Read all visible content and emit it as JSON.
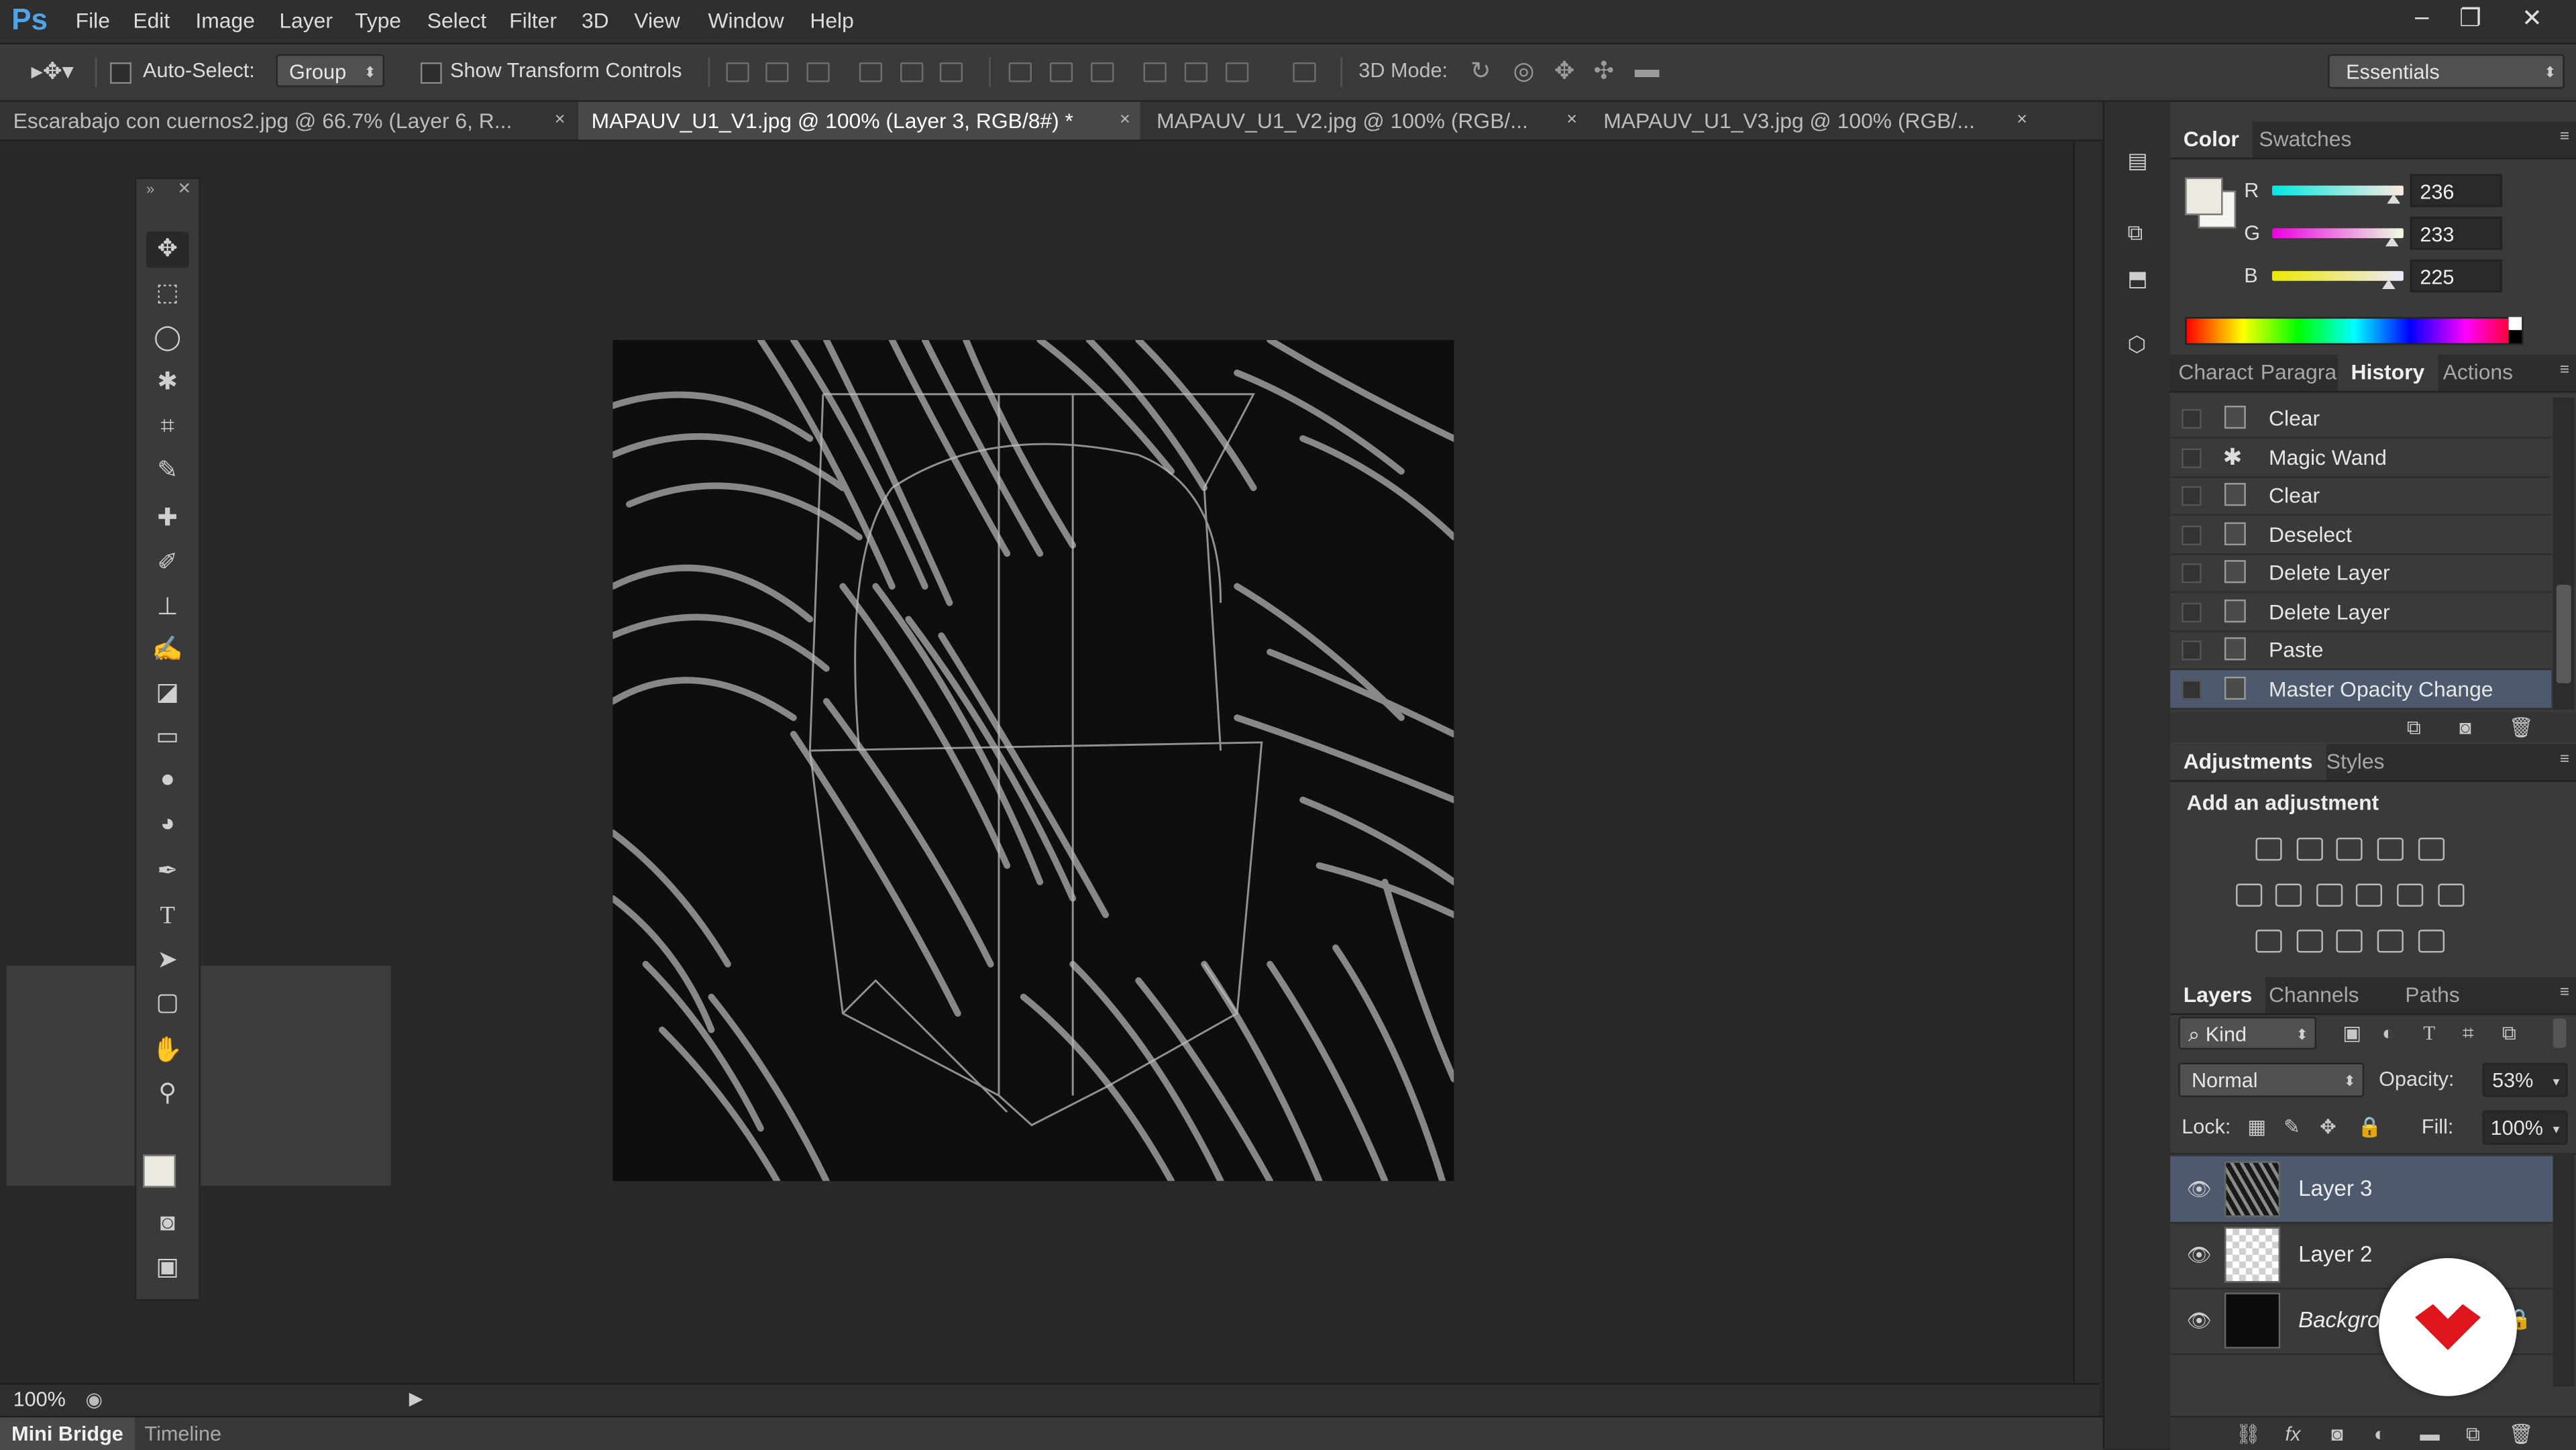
{
  "app": {
    "logo": "Ps"
  },
  "menu": [
    "File",
    "Edit",
    "Image",
    "Layer",
    "Type",
    "Select",
    "Filter",
    "3D",
    "View",
    "Window",
    "Help"
  ],
  "window_controls": {
    "minimize": "–",
    "restore": "❐",
    "close": "✕"
  },
  "options": {
    "auto_select_label": "Auto-Select:",
    "auto_select_value": "Group",
    "show_transform_label": "Show Transform Controls",
    "mode_3d_label": "3D Mode:",
    "workspace": "Essentials"
  },
  "tabs": [
    {
      "label": "Escarabajo con cuernos2.jpg @ 66.7% (Layer 6, R...",
      "close": "×"
    },
    {
      "label": "MAPAUV_U1_V1.jpg @ 100% (Layer 3, RGB/8#) *",
      "close": "×"
    },
    {
      "label": "MAPAUV_U1_V2.jpg @ 100% (RGB/...",
      "close": "×"
    },
    {
      "label": "MAPAUV_U1_V3.jpg @ 100% (RGB/...",
      "close": "×"
    }
  ],
  "status": {
    "zoom": "100%"
  },
  "bottom_tabs": [
    "Mini Bridge",
    "Timeline"
  ],
  "color_panel": {
    "tabs": [
      "Color",
      "Swatches"
    ],
    "channels": [
      {
        "label": "R",
        "value": "236",
        "level": 0.925
      },
      {
        "label": "G",
        "value": "233",
        "level": 0.914
      },
      {
        "label": "B",
        "value": "225",
        "level": 0.882
      }
    ],
    "foreground": "#ece9e1",
    "background": "#f5f5f0"
  },
  "history_panel": {
    "tabs": [
      "Charact",
      "Paragra",
      "History",
      "Actions"
    ],
    "items": [
      "Clear",
      "Magic Wand",
      "Clear",
      "Deselect",
      "Delete Layer",
      "Delete Layer",
      "Paste",
      "Master Opacity Change"
    ]
  },
  "adjustments_panel": {
    "tabs": [
      "Adjustments",
      "Styles"
    ],
    "heading": "Add an adjustment"
  },
  "layers_panel": {
    "tabs": [
      "Layers",
      "Channels",
      "Paths"
    ],
    "kind_label": "Kind",
    "blend_mode": "Normal",
    "opacity_label": "Opacity:",
    "opacity_value": "53%",
    "lock_label": "Lock:",
    "fill_label": "Fill:",
    "fill_value": "100%",
    "layers": [
      {
        "name": "Layer 3",
        "visible": true,
        "selected": true
      },
      {
        "name": "Layer 2",
        "visible": true,
        "selected": false
      },
      {
        "name": "Background",
        "visible": true,
        "selected": false
      }
    ]
  },
  "colors": {
    "accent": "#4fa3e6",
    "selection": "#4d596d",
    "brand_red": "#e0161f"
  }
}
